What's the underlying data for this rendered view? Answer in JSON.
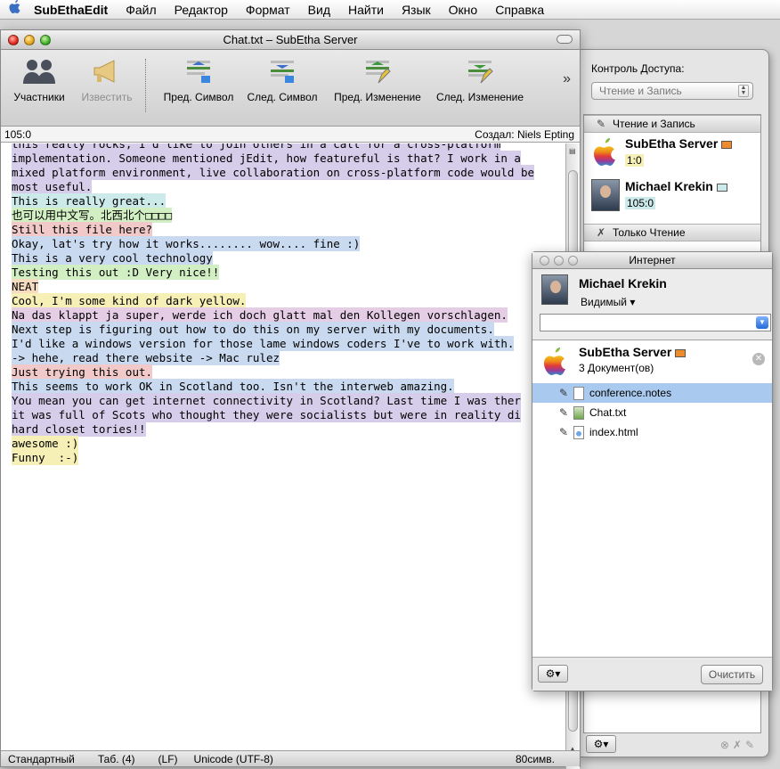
{
  "menubar": {
    "app": "SubEthaEdit",
    "items": [
      "Файл",
      "Редактор",
      "Формат",
      "Вид",
      "Найти",
      "Язык",
      "Окно",
      "Справка"
    ]
  },
  "main_window": {
    "title": "Chat.txt – SubEtha Server",
    "toolbar": {
      "participants": "Участники",
      "announce": "Известить",
      "prev_symbol": "Пред. Символ",
      "next_symbol": "След. Символ",
      "prev_change": "Пред. Изменение",
      "next_change": "След. Изменение",
      "overflow": "»"
    },
    "position": "105:0",
    "created_by": "Создал: Niels Epting",
    "lines": [
      {
        "text": "this really rocks, I'd like to join others in a call for a cross-platform",
        "color": "#d6cdea"
      },
      {
        "text": "implementation. Someone mentioned jEdit, how featureful is that? I work in a",
        "color": "#d6cdea"
      },
      {
        "text": "mixed platform environment, live collaboration on cross-platform code would be",
        "color": "#d6cdea"
      },
      {
        "text": "most useful.",
        "color": "#d6cdea"
      },
      {
        "text": "",
        "color": ""
      },
      {
        "text": "This is really great...",
        "color": "#cdeaea"
      },
      {
        "text": "",
        "color": ""
      },
      {
        "text": "也可以用中文写。北西北个□□□□",
        "color": "#d2efc4"
      },
      {
        "text": "",
        "color": ""
      },
      {
        "text": "Still this file here?",
        "color": "#f2c9c9"
      },
      {
        "text": "",
        "color": ""
      },
      {
        "text": "Okay, lat's try how it works........ wow.... fine :)",
        "color": "#c9d9ef"
      },
      {
        "text": "",
        "color": ""
      },
      {
        "text": "This is a very cool technology",
        "color": "#c9d9ef"
      },
      {
        "text": "",
        "color": ""
      },
      {
        "text": "",
        "color": ""
      },
      {
        "text": "Testing this out :D Very nice!!",
        "color": "#d2efc4"
      },
      {
        "text": "",
        "color": ""
      },
      {
        "text": "",
        "color": ""
      },
      {
        "text": "",
        "color": ""
      },
      {
        "text": "NEAT",
        "color": "#f7dcc0"
      },
      {
        "text": "",
        "color": ""
      },
      {
        "text": "Cool, I'm some kind of dark yellow.",
        "color": "#f6efb6"
      },
      {
        "text": "",
        "color": ""
      },
      {
        "text": "Na das klappt ja super, werde ich doch glatt mal den Kollegen vorschlagen.",
        "color": "#e6cde6"
      },
      {
        "text": "",
        "color": ""
      },
      {
        "text": "Next step is figuring out how to do this on my server with my documents.",
        "color": "#c9d9ef"
      },
      {
        "text": "",
        "color": ""
      },
      {
        "text": "I'd like a windows version for those lame windows coders I've to work with.",
        "color": "#c9d9ef"
      },
      {
        "text": "",
        "color": ""
      },
      {
        "text": "-> hehe, read there website -> Mac rulez",
        "color": "#c9d9ef"
      },
      {
        "text": "",
        "color": ""
      },
      {
        "text": "",
        "color": ""
      },
      {
        "text": "Just trying this out.",
        "color": "#f2c9c9"
      },
      {
        "text": "This seems to work OK in Scotland too. Isn't the interweb amazing.",
        "color": "#c9d9ef"
      },
      {
        "text": "You mean you can get internet connectivity in Scotland? Last time I was ther",
        "color": "#d6cdea"
      },
      {
        "text": "it was full of Scots who thought they were socialists but were in reality di",
        "color": "#d6cdea"
      },
      {
        "text": "hard closet tories!!",
        "color": "#d6cdea"
      },
      {
        "text": "",
        "color": ""
      },
      {
        "text": "awesome :)",
        "color": "#f6efb6"
      },
      {
        "text": "Funny  :-)",
        "color": "#f6efb6"
      }
    ],
    "status": {
      "mode": "Стандартный",
      "tab": "Таб. (4)",
      "line_ending": "(LF)",
      "encoding": "Unicode (UTF-8)",
      "width": "80симв."
    }
  },
  "drawer": {
    "access_label": "Контроль Доступа:",
    "access_value": "Чтение и Запись",
    "read_write_header": "Чтение и Запись",
    "read_only_header": "Только Чтение",
    "participants": [
      {
        "name": "SubEtha Server",
        "position": "1:0",
        "chip": "#f08a2a",
        "pos_bg": "#f6efb6"
      },
      {
        "name": "Michael Krekin",
        "position": "105:0",
        "chip": "#cdeaea",
        "pos_bg": "#cdeaea"
      }
    ]
  },
  "internet": {
    "title": "Интернет",
    "user": "Michael Krekin",
    "status": "Видимый ▾",
    "server": {
      "name": "SubEtha Server",
      "count": "3 Документ(ов)",
      "chip": "#f08a2a"
    },
    "documents": [
      "conference.notes",
      "Chat.txt",
      "index.html"
    ],
    "clear": "Очистить"
  }
}
